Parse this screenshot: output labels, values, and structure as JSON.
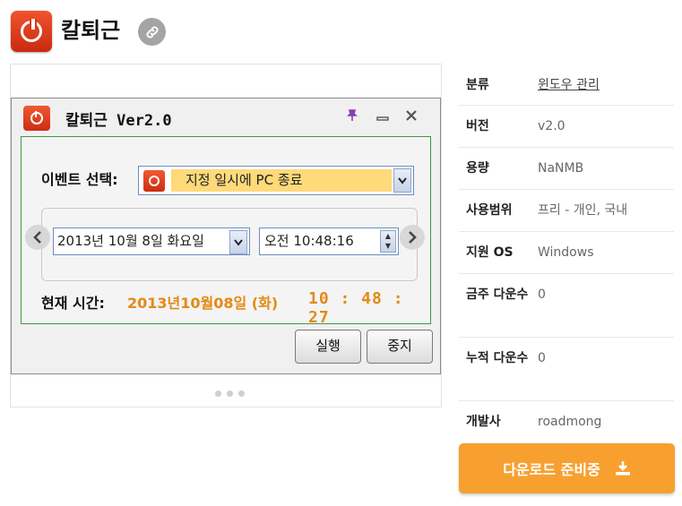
{
  "header": {
    "app_name": "칼퇴근"
  },
  "window": {
    "title": "칼퇴근 Ver2.0",
    "event_label": "이벤트 선택:",
    "event_value": "지정 일시에 PC 종료",
    "date_value": "2013년 10월   8일 화요일",
    "time_value": "오전 10:48:16",
    "now_label": "현재 시간:",
    "now_date": "2013년10월08일 (화)",
    "now_time": "10 : 48 : 27",
    "run_button": "실행",
    "stop_button": "중지"
  },
  "info": [
    {
      "key": "분류",
      "value": "윈도우 관리",
      "link": true
    },
    {
      "key": "버전",
      "value": "v2.0"
    },
    {
      "key": "용량",
      "value": "NaNMB"
    },
    {
      "key": "사용범위",
      "value": "프리 - 개인, 국내"
    },
    {
      "key": "지원 OS",
      "value": "Windows"
    },
    {
      "key": "금주 다운수",
      "value": "0"
    },
    {
      "key": "누적 다운수",
      "value": "0"
    },
    {
      "key": "개발사",
      "value": "roadmong"
    }
  ],
  "download_button": "다운로드 준비중",
  "icons": [
    "app-logo-icon",
    "link-icon",
    "pin-icon",
    "minimize-icon",
    "close-icon",
    "chevron-left-icon",
    "chevron-right-icon",
    "download-icon"
  ]
}
